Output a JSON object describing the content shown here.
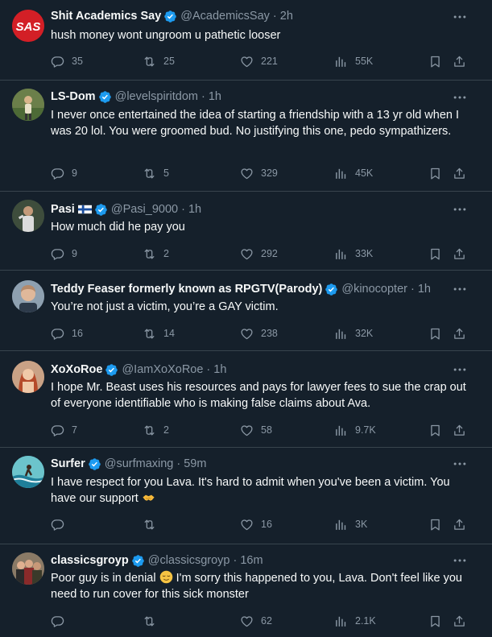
{
  "tweets": [
    {
      "name": "Shit Academics Say",
      "handle": "@AcademicsSay",
      "time": "2h",
      "avatar_text": "SAS",
      "text": "hush money wont ungroom u pathetic looser",
      "replies": "35",
      "retweets": "25",
      "likes": "221",
      "views": "55K"
    },
    {
      "name": "LS-Dom",
      "handle": "@levelspiritdom",
      "time": "1h",
      "text": "I never once entertained the idea of starting a friendship with a 13 yr old when I was 20 lol. You were groomed bud. No justifying this one, pedo sympathizers.",
      "replies": "9",
      "retweets": "5",
      "likes": "329",
      "views": "45K"
    },
    {
      "name": "Pasi",
      "handle": "@Pasi_9000",
      "time": "1h",
      "text": "How much did he pay you",
      "replies": "9",
      "retweets": "2",
      "likes": "292",
      "views": "33K"
    },
    {
      "name": "Teddy Feaser formerly known as RPGTV(Parody)",
      "handle": "@kinocopter",
      "time": "1h",
      "text": "You’re not just a victim, you’re a GAY victim.",
      "replies": "16",
      "retweets": "14",
      "likes": "238",
      "views": "32K"
    },
    {
      "name": "XoXoRoe",
      "handle": "@IamXoXoRoe",
      "time": "1h",
      "text": "I hope Mr. Beast uses his resources and pays for lawyer fees to sue the crap out of everyone identifiable who is making false claims about Ava.",
      "replies": "7",
      "retweets": "2",
      "likes": "58",
      "views": "9.7K"
    },
    {
      "name": "Surfer",
      "handle": "@surfmaxing",
      "time": "59m",
      "text": "I have respect for you Lava. It's hard to admit when you've been a victim. You have our support",
      "replies": "",
      "retweets": "",
      "likes": "16",
      "views": "3K"
    },
    {
      "name": "classicsgroyp",
      "handle": "@classicsgroyp",
      "time": "16m",
      "text_a": "Poor guy is in denial",
      "text_b": "I'm sorry this happened to you, Lava. Don't feel like you need to run cover for this sick monster",
      "replies": "",
      "retweets": "",
      "likes": "62",
      "views": "2.1K"
    }
  ],
  "colors": {
    "background": "#15202b",
    "divider": "#38444d",
    "muted": "#8b98a5",
    "verified": "#1d9bf0"
  },
  "icons": [
    "reply-icon",
    "retweet-icon",
    "like-icon",
    "views-icon",
    "bookmark-icon",
    "share-icon",
    "verified-badge-icon",
    "more-icon",
    "finland-flag-icon",
    "handshake-emoji",
    "relieved-face-emoji"
  ]
}
